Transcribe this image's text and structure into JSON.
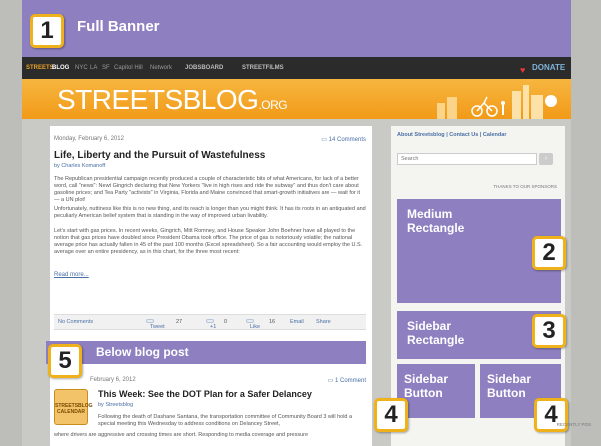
{
  "banner": {
    "number": "1",
    "title": "Full Banner"
  },
  "nav": {
    "brand_a": "STREETS",
    "brand_b": "BLOG",
    "links": [
      "NYC",
      "LA",
      "SF",
      "Capitol Hill",
      "Network"
    ],
    "jobs": "JOBSBOARD",
    "films": "STREETFILMS",
    "donate": "DONATE"
  },
  "masthead": {
    "logo": "STREETSBLOG",
    "logo_suffix": ".ORG"
  },
  "post1": {
    "date": "Monday, February 6, 2012",
    "comments": "14 Comments",
    "title": "Life, Liberty and the Pursuit of Wastefulness",
    "byline": "by Charles Komanoff",
    "p1": "The Republican presidential campaign recently produced a couple of characteristic bits of what Americans, for lack of a better word, call \"news\": Newt Gingrich declaring that New Yorkers \"live in high rises and ride the subway\" and thus don't care about gasoline prices; and Tea Party \"activists\" in Virginia, Florida and Maine convinced that smart-growth initiatives are — wait for it — a UN plot!",
    "p2": "Unfortunately, nuttiness like this is no new thing, and its reach is longer than you might think. It has its roots in an antiquated and peculiarly American belief system that is standing in the way of improved urban livability.",
    "p3": "Let's start with gas prices. In recent weeks, Gingrich, Mitt Romney, and House Speaker John Boehner have all played to the notion that gas prices have doubled since President Obama took office. The price of gas is notoriously volatile; the national average price has actually fallen in 45 of the past 100 months (Excel spreadsheet). So a fair accounting would employ the U.S. average over an entire presidency, as in this chart, for the three most recent:",
    "more": "Read more..."
  },
  "sharebar": {
    "no_comments": "No Comments",
    "tweet": "Tweet",
    "tweet_count": "27",
    "plus": "+1",
    "plus_count": "0",
    "like": "Like",
    "like_count": "16",
    "email": "Email",
    "share": "Share"
  },
  "below_post": {
    "number": "5",
    "title": "Below blog post"
  },
  "post2": {
    "date": "February 6, 2012",
    "comments": "1 Comment",
    "title": "This Week: See the DOT Plan for a Safer Delancey",
    "byline": "by Streetsblog",
    "calendar_label": "STREETSBLOG CALENDAR",
    "p1": "Following the death of Dashane Santana, the transportation committee of Community Board 3 will hold a special meeting this Wednesday to address conditions on Delancey Street,",
    "p2": "where drivers are aggressive and crossing times are short. Responding to media coverage and pressure"
  },
  "sidebar": {
    "links": [
      "About Streetsblog",
      "Contact Us",
      "Calendar"
    ],
    "search_placeholder": "Search",
    "thanks": "THANKS TO OUR SPONSORS",
    "recent": "RECENTLY POS"
  },
  "ads": {
    "medium": {
      "number": "2",
      "label": "Medium Rectangle"
    },
    "rect": {
      "number": "3",
      "label": "Sidebar Rectangle"
    },
    "button_a": {
      "number": "4",
      "label": "Sidebar Button"
    },
    "button_b": {
      "number": "4",
      "label": "Sidebar Button"
    }
  },
  "colors": {
    "ad_purple": "#8e80c0",
    "badge_border": "#f0b21a",
    "masthead_orange": "#f29a18"
  }
}
